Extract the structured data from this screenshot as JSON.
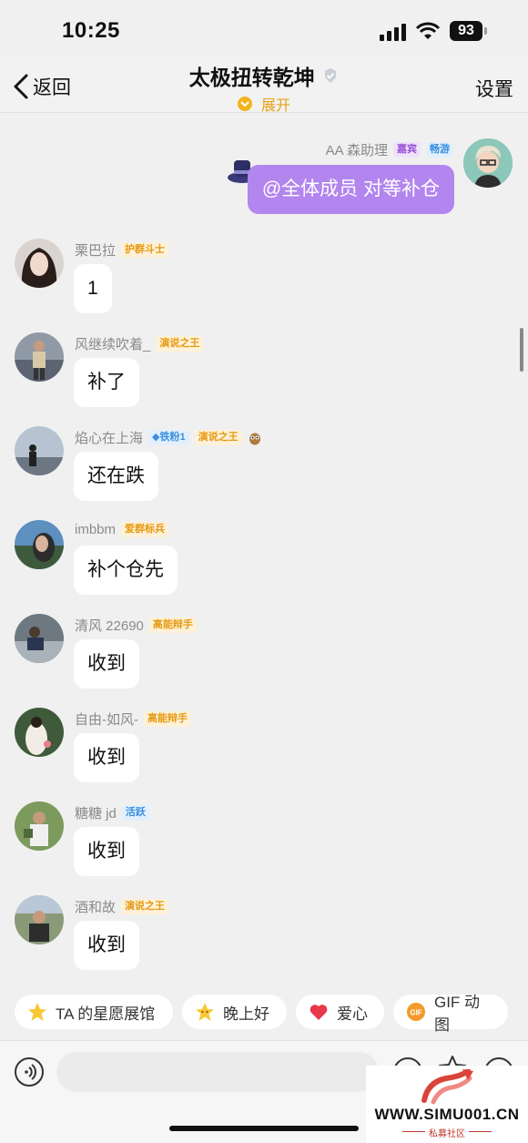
{
  "status_bar": {
    "time": "10:25",
    "battery": "93"
  },
  "header": {
    "back_label": "返回",
    "title": "太极扭转乾坤",
    "expand_label": "展开",
    "settings_label": "设置"
  },
  "messages": [
    {
      "name": "AA 森助理",
      "badges": [
        "嘉宾",
        "畅游"
      ],
      "text": "@全体成员 对等补仓",
      "mine": true
    },
    {
      "name": "栗巴拉",
      "badges": [
        "护群斗士"
      ],
      "text": "1"
    },
    {
      "name": "风继续吹着_",
      "badges": [
        "演说之王"
      ],
      "text": "补了"
    },
    {
      "name": "焰心在上海",
      "badges": [
        "铁粉1",
        "演说之王"
      ],
      "text": "还在跌"
    },
    {
      "name": "imbbm",
      "badges": [
        "爱群标兵"
      ],
      "text": "补个仓先"
    },
    {
      "name": "清风 22690",
      "badges": [
        "高能辩手"
      ],
      "text": "收到"
    },
    {
      "name": "自由-如风-",
      "badges": [
        "高能辩手"
      ],
      "text": "收到"
    },
    {
      "name": "糖糖 jd",
      "badges": [
        "活跃"
      ],
      "text": "收到"
    },
    {
      "name": "酒和故",
      "badges": [
        "演说之王"
      ],
      "text": "收到"
    }
  ],
  "quick_replies": [
    "TA 的星愿展馆",
    "晚上好",
    "爱心",
    "GIF 动图"
  ],
  "input": {
    "value": ""
  },
  "watermark": {
    "text": "WWW.SIMU001.CN",
    "sub": "私募社区"
  },
  "colors": {
    "accent_purple": "#b385ee",
    "badge_orange": "#e69a12",
    "badge_blue": "#3b8fe0",
    "badge_purple": "#9b52d8",
    "expand_yellow": "#f3b51d"
  },
  "icons": {
    "back": "chevron-left-icon",
    "verified": "verified-badge-icon",
    "voice": "voice-icon",
    "emoji": "emoji-icon",
    "favorite": "favorite-icon",
    "plus": "plus-icon"
  }
}
